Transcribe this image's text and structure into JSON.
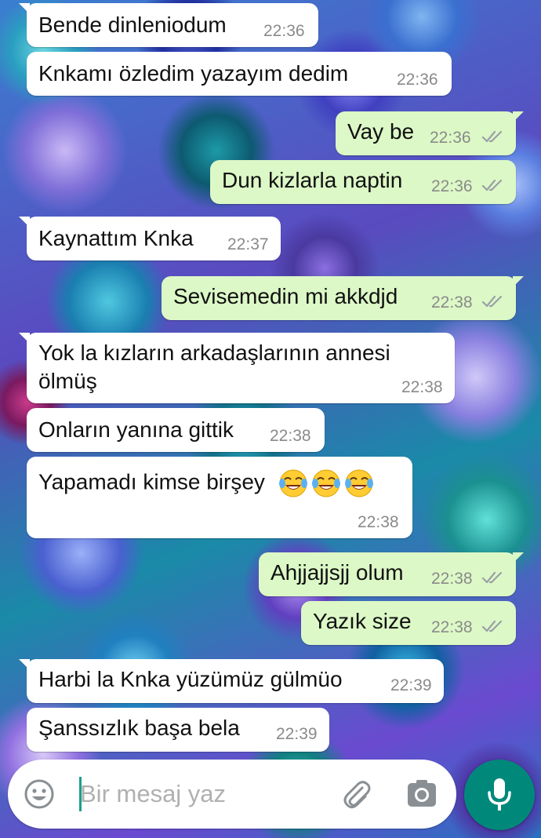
{
  "messages": [
    {
      "dir": "in",
      "text": "Bende dinleniodum",
      "time": "22:36"
    },
    {
      "dir": "in",
      "text": "Knkamı özledim yazayım dedim",
      "time": "22:36"
    },
    {
      "dir": "out",
      "text": "Vay be",
      "time": "22:36",
      "status": "read"
    },
    {
      "dir": "out",
      "text": "Dun kizlarla naptin",
      "time": "22:36",
      "status": "read"
    },
    {
      "dir": "in",
      "text": "Kaynattım Knka",
      "time": "22:37"
    },
    {
      "dir": "out",
      "text": "Sevisemedin mi akkdjd",
      "time": "22:38",
      "status": "read"
    },
    {
      "dir": "in",
      "text_line1": "Yok la kızların arkadaşlarının annesi",
      "text_line2": "ölmüş",
      "time": "22:38"
    },
    {
      "dir": "in",
      "text": "Onların yanına gittik",
      "time": "22:38"
    },
    {
      "dir": "in",
      "text": "Yapamadı kimse birşey",
      "emoji": "face-with-tears-of-joy x3",
      "time": "22:38"
    },
    {
      "dir": "out",
      "text": "Ahjjajjsjj olum",
      "time": "22:38",
      "status": "read"
    },
    {
      "dir": "out",
      "text": "Yazık size",
      "time": "22:38",
      "status": "read"
    },
    {
      "dir": "in",
      "text": "Harbi la Knka yüzümüz gülmüo",
      "time": "22:39"
    },
    {
      "dir": "in",
      "text": "Şanssızlık başa bela",
      "time": "22:39"
    }
  ],
  "composer": {
    "placeholder": "Bir mesaj yaz",
    "icons": [
      "emoji-icon",
      "attachment-icon",
      "camera-icon",
      "microphone-icon"
    ]
  },
  "colors": {
    "incoming_bubble": "#ffffff",
    "outgoing_bubble": "#dcf8c6",
    "mic_button": "#00897b",
    "read_ticks": "#9aa0a6"
  }
}
